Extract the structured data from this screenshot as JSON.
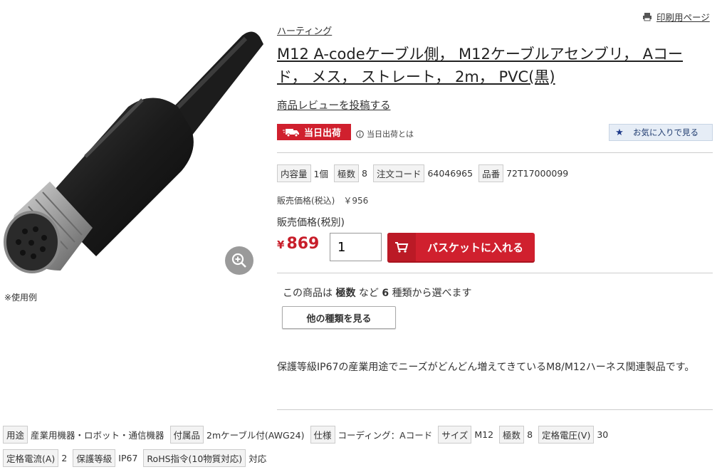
{
  "header": {
    "print_label": "印刷用ページ",
    "brand": "ハーティング",
    "title": "M12 A-codeケーブル側， M12ケーブルアセンブリ， Aコード， メス， ストレート， 2m， PVC(黒)",
    "review_link": "商品レビューを投稿する"
  },
  "image": {
    "note": "※使用例"
  },
  "badges": {
    "sameday": "当日出荷",
    "sameday_info": "当日出荷とは",
    "favorite": "お気に入りで見る"
  },
  "specs": [
    {
      "label": "内容量",
      "value": "1個"
    },
    {
      "label": "極数",
      "value": "8"
    },
    {
      "label": "注文コード",
      "value": "64046965"
    },
    {
      "label": "品番",
      "value": "72T17000099"
    }
  ],
  "price": {
    "tax_in": "販売価格(税込)　￥956",
    "label": "販売価格(税別)",
    "currency": "¥",
    "amount": "869",
    "quantity": "1",
    "basket_button": "バスケットに入れる"
  },
  "variants": {
    "prefix": "この商品は",
    "attr": "極数",
    "middle": "など",
    "count": "6",
    "suffix": "種類から選べます",
    "button": "他の種類を見る"
  },
  "description": "保護等級IP67の産業用途でニーズがどんどん増えてきているM8/M12ハーネス関連製品です。",
  "attributes_row1": [
    {
      "label": "用途",
      "value": "産業用機器・ロボット・通信機器"
    },
    {
      "label": "付属品",
      "value": "2mケーブル付(AWG24)"
    },
    {
      "label": "仕様",
      "value": "コーディング：Aコード"
    },
    {
      "label": "サイズ",
      "value": "M12"
    },
    {
      "label": "極数",
      "value": "8"
    },
    {
      "label": "定格電圧(V)",
      "value": "30"
    }
  ],
  "attributes_row2": [
    {
      "label": "定格電流(A)",
      "value": "2"
    },
    {
      "label": "保護等級",
      "value": "IP67"
    },
    {
      "label": "RoHS指令(10物質対応)",
      "value": "対応"
    }
  ],
  "colors": {
    "accent": "#d0202e",
    "price": "#c81e2a",
    "favorite_bg": "#e6edf6"
  },
  "icons": [
    "printer-icon",
    "zoom-icon",
    "truck-icon",
    "info-icon",
    "star-icon",
    "cart-icon"
  ]
}
